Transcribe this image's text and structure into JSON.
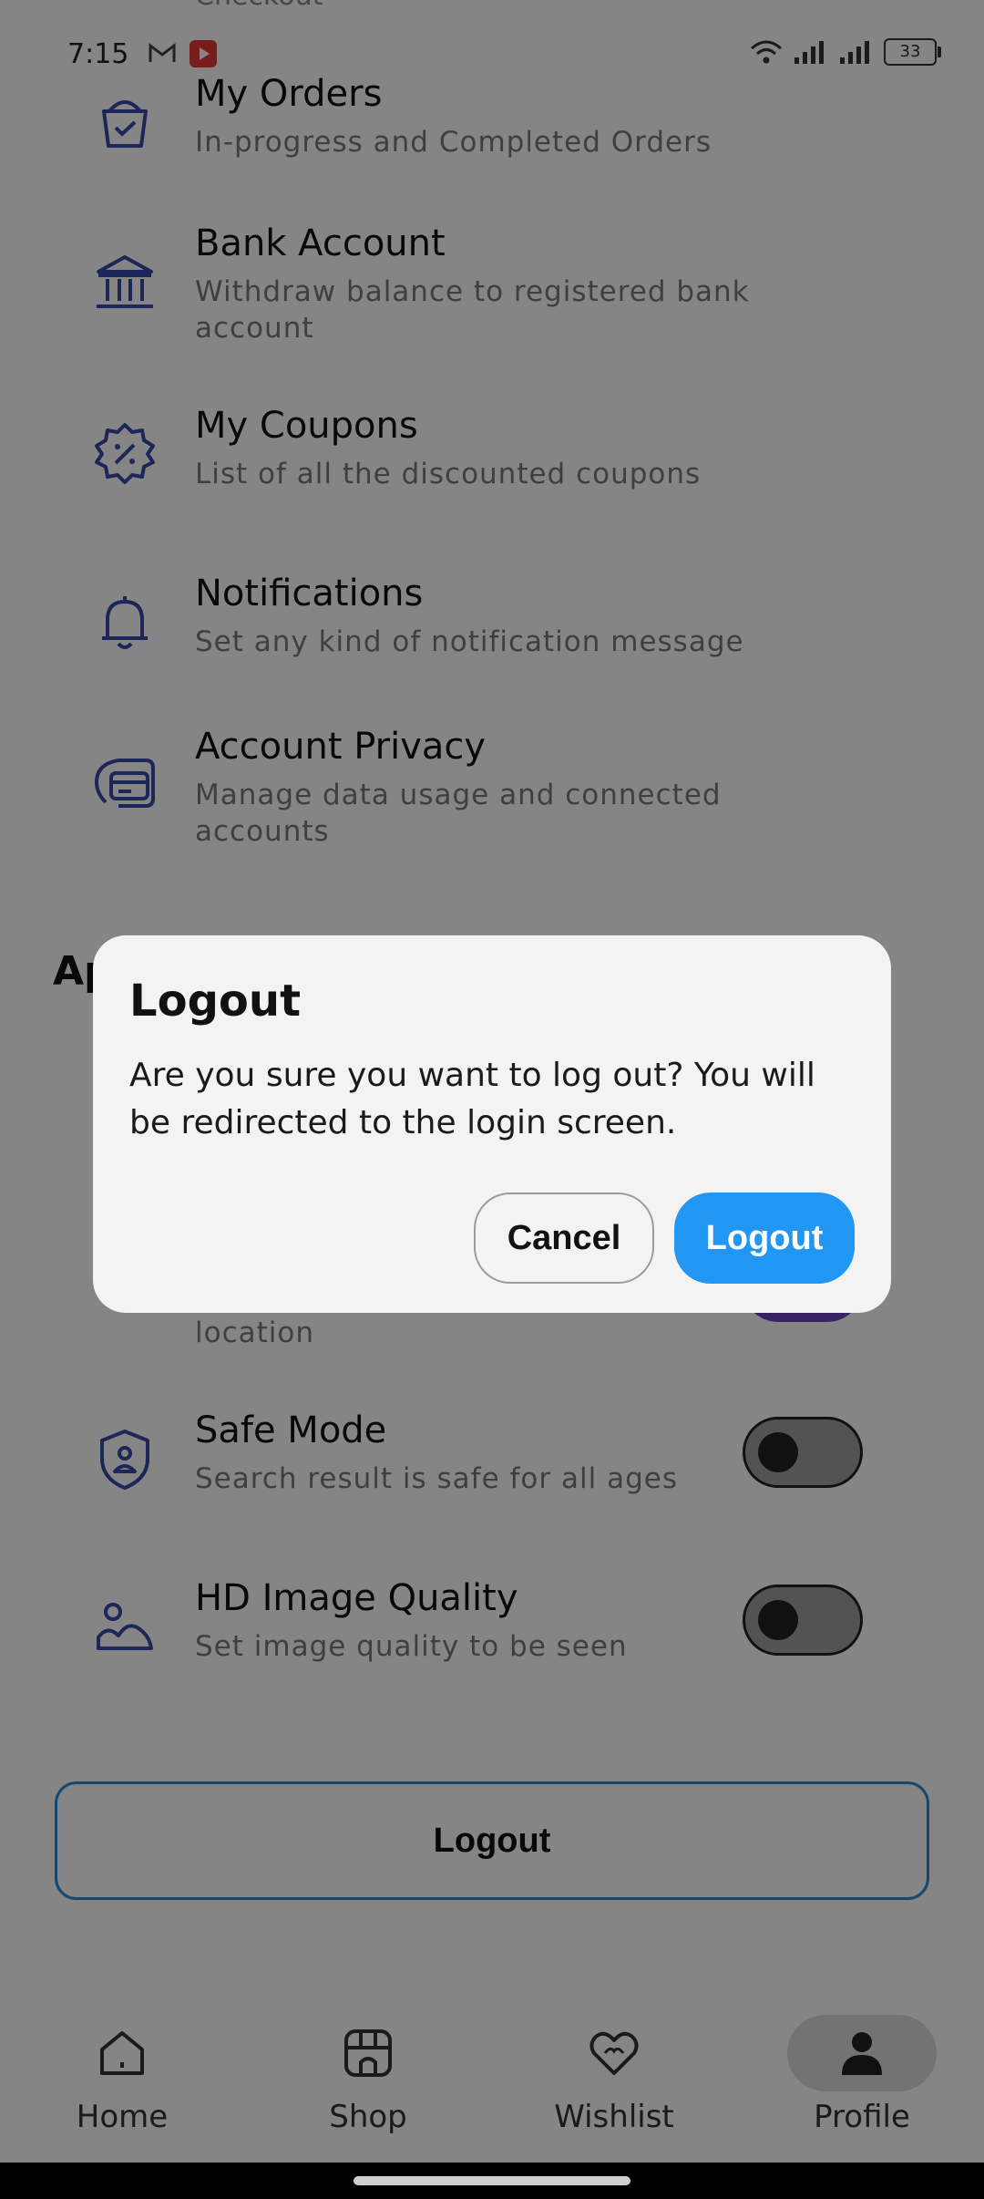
{
  "status_bar": {
    "time": "7:15",
    "battery": "33"
  },
  "cut_item": {
    "label": "Checkout"
  },
  "account_settings": [
    {
      "icon": "bag-check-icon",
      "title": "My Orders",
      "subtitle": "In-progress and Completed Orders"
    },
    {
      "icon": "bank-icon",
      "title": "Bank Account",
      "subtitle": "Withdraw balance to registered bank account"
    },
    {
      "icon": "coupon-icon",
      "title": "My Coupons",
      "subtitle": "List of all the discounted coupons"
    },
    {
      "icon": "bell-icon",
      "title": "Notifications",
      "subtitle": "Set any kind of notification message"
    },
    {
      "icon": "privacy-card-icon",
      "title": "Account Privacy",
      "subtitle": "Manage data usage and connected accounts"
    }
  ],
  "app_settings": {
    "heading_fragment": "Ap",
    "geolocation_subtitle_fragment": "location",
    "safe_mode": {
      "title": "Safe Mode",
      "subtitle": "Search result is safe for all ages",
      "enabled": false
    },
    "hd_image": {
      "title": "HD Image Quality",
      "subtitle": "Set image quality to be seen",
      "enabled": false
    }
  },
  "logout_button": {
    "label": "Logout"
  },
  "dialog": {
    "title": "Logout",
    "message": "Are you sure you want to log out? You will be redirected to the login screen.",
    "cancel_label": "Cancel",
    "confirm_label": "Logout"
  },
  "bottom_nav": [
    {
      "label": "Home",
      "icon": "home-icon"
    },
    {
      "label": "Shop",
      "icon": "shop-icon"
    },
    {
      "label": "Wishlist",
      "icon": "heart-icon"
    },
    {
      "label": "Profile",
      "icon": "user-icon",
      "active": true
    }
  ],
  "colors": {
    "accent": "#2196f3",
    "icon": "#3949ab",
    "scrim": "#00000075",
    "toggle_on": "#6b46c1"
  }
}
